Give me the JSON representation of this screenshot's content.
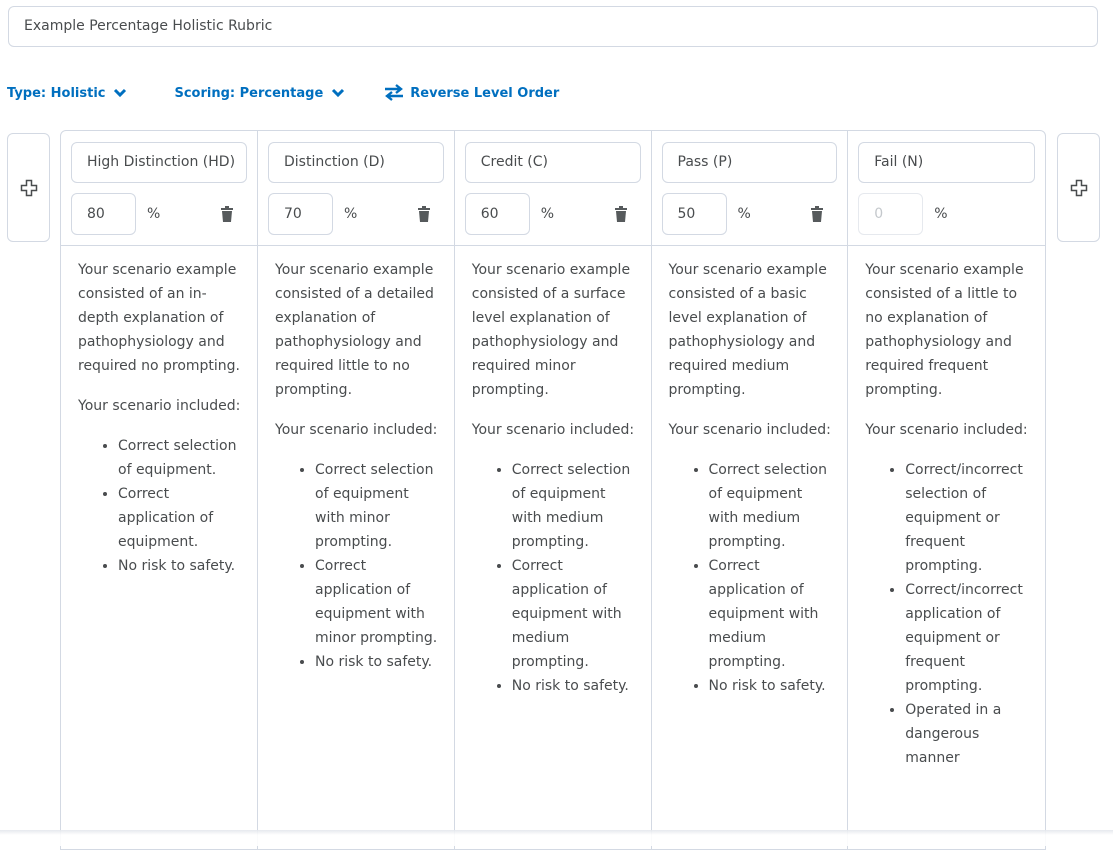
{
  "rubric_name": "Example Percentage Holistic Rubric",
  "toolbar": {
    "type": "Type: Holistic",
    "scoring": "Scoring: Percentage",
    "reverse": "Reverse Level Order"
  },
  "colors": {
    "accent": "#006fbf",
    "border": "#d3d9e3"
  },
  "levels": [
    {
      "name": "High Distinction (HD)",
      "percent": "80",
      "unit": "%",
      "intro": "Your scenario example consisted of an in-depth explanation of pathophysiology and required no prompting.",
      "included": "Your scenario included:",
      "bullets": [
        "Correct selection of equipment.",
        "Correct application of equipment.",
        "No risk to safety."
      ]
    },
    {
      "name": "Distinction (D)",
      "percent": "70",
      "unit": "%",
      "intro": "Your scenario example consisted of a detailed explanation of pathophysiology and required little to no prompting.",
      "included": "Your scenario included:",
      "bullets": [
        "Correct selection of equipment with minor prompting.",
        "Correct application of equipment with minor prompting.",
        "No risk to safety."
      ]
    },
    {
      "name": "Credit (C)",
      "percent": "60",
      "unit": "%",
      "intro": "Your scenario example consisted of a surface level explanation of pathophysiology and required minor prompting.",
      "included": "Your scenario included:",
      "bullets": [
        "Correct selection of equipment with medium prompting.",
        "Correct application of equipment with medium prompting.",
        "No risk to safety."
      ]
    },
    {
      "name": "Pass (P)",
      "percent": "50",
      "unit": "%",
      "intro": "Your scenario example consisted of a basic level explanation of pathophysiology and required medium prompting.",
      "included": "Your scenario included:",
      "bullets": [
        "Correct selection of equipment with medium prompting.",
        "Correct application of equipment with medium prompting.",
        "No risk to safety."
      ]
    },
    {
      "name": "Fail (N)",
      "percent": "0",
      "unit": "%",
      "intro": "Your scenario example consisted of a little to no explanation of pathophysiology and required frequent prompting.",
      "included": "Your scenario included:",
      "bullets": [
        "Correct/incorrect selection of equipment or frequent prompting.",
        "Correct/incorrect application of equipment or frequent prompting.",
        "Operated in a dangerous manner"
      ]
    }
  ]
}
